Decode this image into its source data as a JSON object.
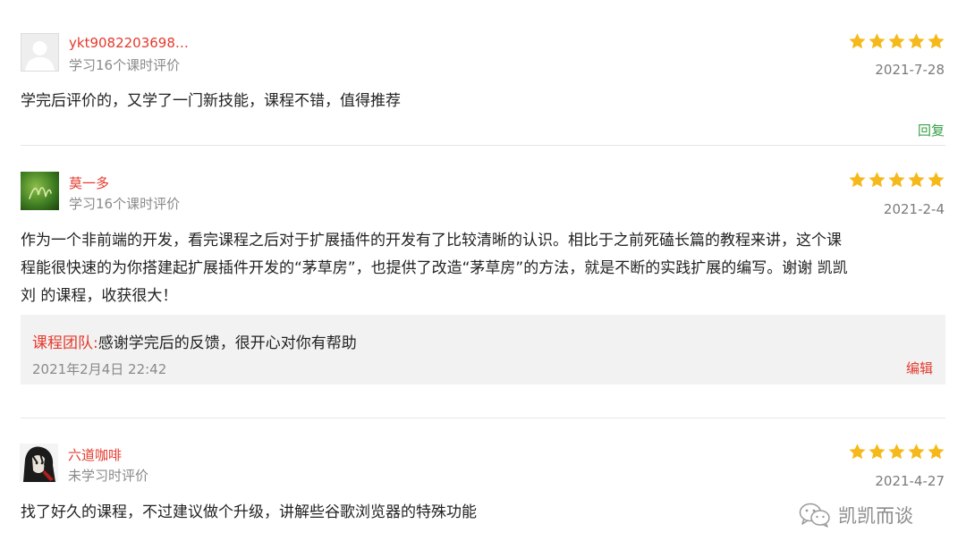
{
  "reviews": [
    {
      "username": "ykt9082203698…",
      "progress": "学习16个课时评价",
      "rating": 5,
      "date": "2021-7-28",
      "text": "学完后评价的，又学了一门新技能，课程不错，值得推荐",
      "reply_label": "回复"
    },
    {
      "username": "莫一多",
      "progress": "学习16个课时评价",
      "rating": 5,
      "date": "2021-2-4",
      "text_lines": [
        "作为一个非前端的开发，看完课程之后对于扩展插件的开发有了比较清晰的认识。相比于之前死磕长篇的教程来讲，这个课",
        "程能很快速的为你搭建起扩展插件开发的“茅草房”，也提供了改造“茅草房”的方法，就是不断的实践扩展的编写。谢谢 凯凯",
        "刘 的课程，收获很大！"
      ],
      "team_reply": {
        "label": "课程团队:",
        "text": "感谢学完后的反馈，很开心对你有帮助",
        "time": "2021年2月4日 22:42",
        "edit_label": "编辑"
      }
    },
    {
      "username": "六道咖啡",
      "progress": "未学习时评价",
      "rating": 5,
      "date": "2021-4-27",
      "text": "找了好久的课程，不过建议做个升级，讲解些谷歌浏览器的特殊功能"
    }
  ],
  "watermark": {
    "text": "凯凯而谈",
    "icon": "wechat-icon"
  },
  "colors": {
    "accent_red": "#e5392c",
    "reply_green": "#3aa04a",
    "star_gold": "#f6b91b",
    "meta_gray": "#8a8a8a"
  }
}
